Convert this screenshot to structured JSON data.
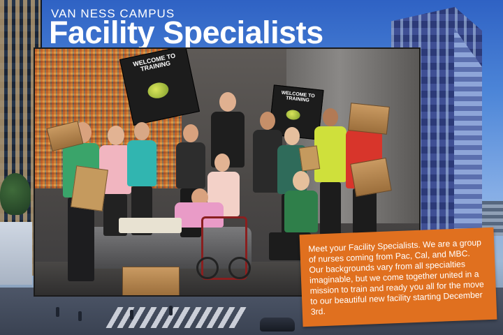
{
  "header": {
    "campus_label": "VAN NESS CAMPUS",
    "title": "Facility Specialists"
  },
  "photo": {
    "poster_1_heading": "WELCOME TO TRAINING",
    "poster_2_heading": "WELCOME TO TRAINING"
  },
  "caption": {
    "text": "Meet your Facility Specialists. We are a group of nurses coming from Pac, Cal, and MBC. Our backgrounds vary from all specialties imaginable, but we come together united in a mission to train and ready you all for the move to our beautiful new facility starting December 3rd."
  },
  "colors": {
    "caption_background": "#e0701f",
    "title_text": "#ffffff",
    "sky": "#2f62c4"
  }
}
